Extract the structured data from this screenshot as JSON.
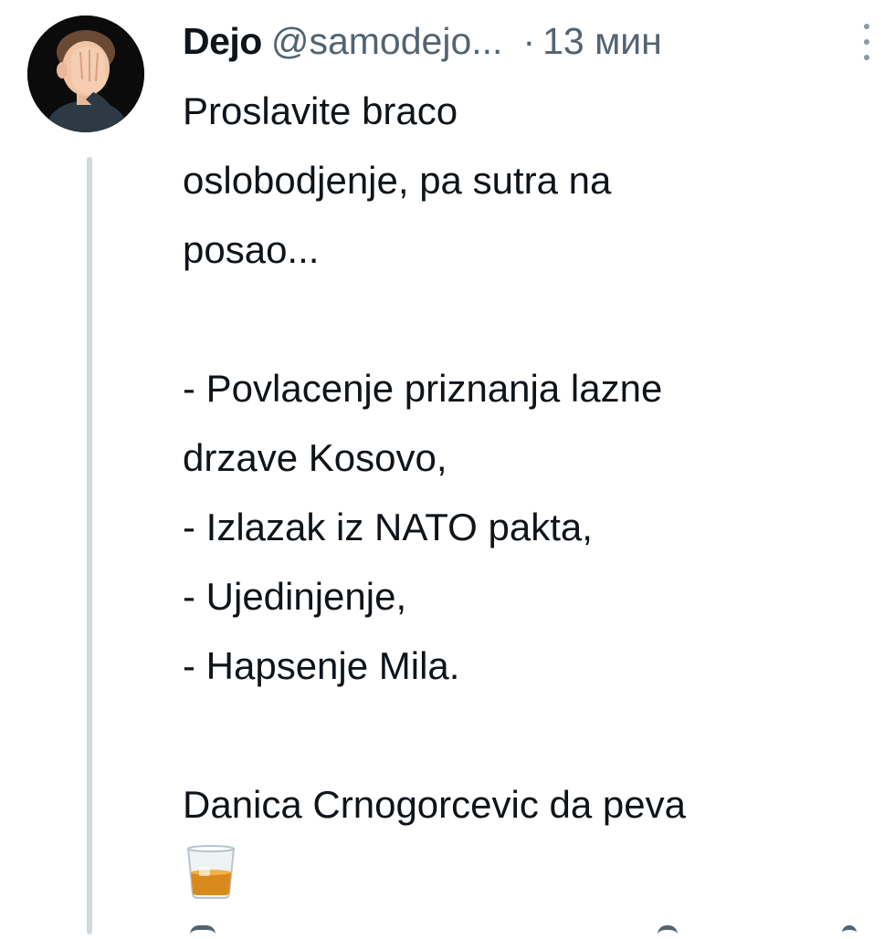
{
  "tweet": {
    "display_name": "Dejo",
    "handle": "@samodejo...",
    "separator": "·",
    "time": "13 мин",
    "lines": [
      "Proslavite braco",
      "oslobodjenje, pa sutra na",
      "posao...",
      "",
      "- Povlacenje priznanja lazne",
      "drzave Kosovo,",
      "- Izlazak iz NATO pakta,",
      "- Ujedinjenje,",
      "- Hapsenje Mila.",
      "",
      "Danica Crnogorcevic da peva"
    ],
    "emoji": "tumbler-glass-emoji",
    "avatar_icon": "facepalm-memoji",
    "more_icon": "more-options-icon"
  }
}
